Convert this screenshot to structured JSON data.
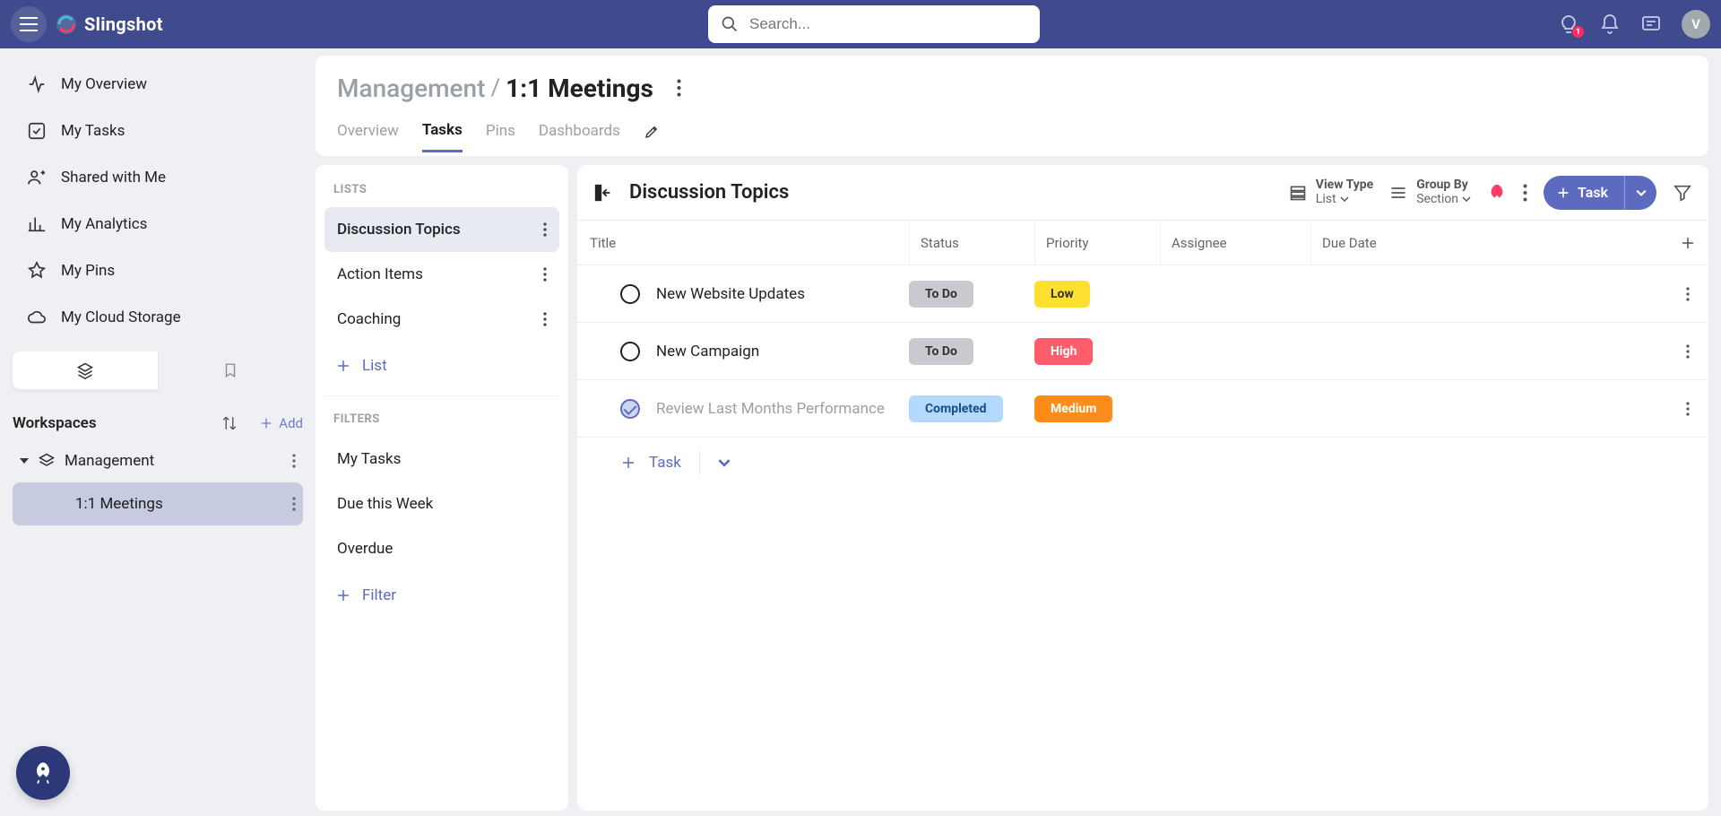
{
  "app": {
    "name": "Slingshot",
    "search_placeholder": "Search...",
    "avatar_initial": "V",
    "notif_badge": "1"
  },
  "sidebar": {
    "items": [
      {
        "label": "My Overview"
      },
      {
        "label": "My Tasks"
      },
      {
        "label": "Shared with Me"
      },
      {
        "label": "My Analytics"
      },
      {
        "label": "My Pins"
      },
      {
        "label": "My Cloud Storage"
      }
    ],
    "workspaces_label": "Workspaces",
    "add_label": "Add",
    "workspace": {
      "name": "Management",
      "child": "1:1 Meetings"
    }
  },
  "header": {
    "breadcrumb_parent": "Management",
    "breadcrumb_current": "1:1 Meetings",
    "tabs": [
      "Overview",
      "Tasks",
      "Pins",
      "Dashboards"
    ],
    "active_tab": "Tasks"
  },
  "lists_panel": {
    "heading_lists": "LISTS",
    "heading_filters": "FILTERS",
    "lists": [
      "Discussion Topics",
      "Action Items",
      "Coaching"
    ],
    "add_list_label": "List",
    "filters": [
      "My Tasks",
      "Due this Week",
      "Overdue"
    ],
    "add_filter_label": "Filter"
  },
  "tasks_panel": {
    "title": "Discussion Topics",
    "view_type_label": "View Type",
    "view_type_value": "List",
    "group_by_label": "Group By",
    "group_by_value": "Section",
    "task_button_label": "Task",
    "add_task_label": "Task",
    "columns": {
      "title": "Title",
      "status": "Status",
      "priority": "Priority",
      "assignee": "Assignee",
      "due": "Due Date"
    },
    "rows": [
      {
        "title": "New Website Updates",
        "status": "To Do",
        "status_class": "status-todo",
        "priority": "Low",
        "priority_class": "prio-low",
        "completed": false
      },
      {
        "title": "New Campaign",
        "status": "To Do",
        "status_class": "status-todo",
        "priority": "High",
        "priority_class": "prio-high",
        "completed": false
      },
      {
        "title": "Review Last Months Performance",
        "status": "Completed",
        "status_class": "status-completed",
        "priority": "Medium",
        "priority_class": "prio-medium",
        "completed": true
      }
    ]
  }
}
